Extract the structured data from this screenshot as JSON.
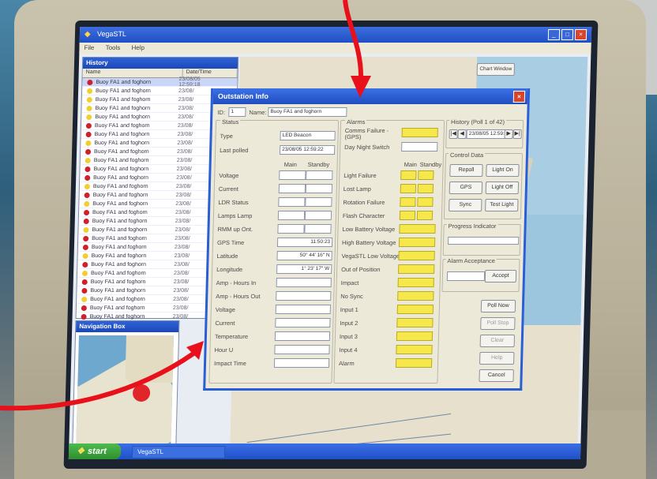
{
  "app": {
    "title": "VegaSTL",
    "menu": [
      "File",
      "Tools",
      "Help"
    ],
    "taskbar_item": "VegaSTL"
  },
  "start_label": "start",
  "history": {
    "title": "History",
    "columns": [
      "Name",
      "Date/Time"
    ],
    "rows": [
      {
        "name": "Buoy FA1 and foghorn",
        "time": "23/08/05 12:59:18",
        "status": "red"
      },
      {
        "name": "Buoy FA1 and foghorn",
        "time": "23/08/",
        "status": "yellow"
      },
      {
        "name": "Buoy FA1 and foghorn",
        "time": "23/08/",
        "status": "yellow"
      },
      {
        "name": "Buoy FA1 and foghorn",
        "time": "23/08/",
        "status": "yellow"
      },
      {
        "name": "Buoy FA1 and foghorn",
        "time": "23/08/",
        "status": "yellow"
      },
      {
        "name": "Buoy FA1 and foghorn",
        "time": "23/08/",
        "status": "red"
      },
      {
        "name": "Buoy FA1 and foghorn",
        "time": "23/08/",
        "status": "red"
      },
      {
        "name": "Buoy FA1 and foghorn",
        "time": "23/08/",
        "status": "yellow"
      },
      {
        "name": "Buoy FA1 and foghorn",
        "time": "23/08/",
        "status": "red"
      },
      {
        "name": "Buoy FA1 and foghorn",
        "time": "23/08/",
        "status": "yellow"
      },
      {
        "name": "Buoy FA1 and foghorn",
        "time": "23/08/",
        "status": "red"
      },
      {
        "name": "Buoy FA1 and foghorn",
        "time": "23/08/",
        "status": "red"
      },
      {
        "name": "Buoy FA1 and foghorn",
        "time": "23/08/",
        "status": "yellow"
      },
      {
        "name": "Buoy FA1 and foghorn",
        "time": "23/08/",
        "status": "red"
      },
      {
        "name": "Buoy FA1 and foghorn",
        "time": "23/08/",
        "status": "yellow"
      },
      {
        "name": "Buoy FA1 and foghorn",
        "time": "23/08/",
        "status": "red"
      },
      {
        "name": "Buoy FA1 and foghorn",
        "time": "23/08/",
        "status": "red"
      },
      {
        "name": "Buoy FA1 and foghorn",
        "time": "23/08/",
        "status": "yellow"
      },
      {
        "name": "Buoy FA1 and foghorn",
        "time": "23/08/",
        "status": "red"
      },
      {
        "name": "Buoy FA1 and foghorn",
        "time": "23/08/",
        "status": "red"
      },
      {
        "name": "Buoy FA1 and foghorn",
        "time": "23/08/",
        "status": "yellow"
      },
      {
        "name": "Buoy FA1 and foghorn",
        "time": "23/08/",
        "status": "red"
      },
      {
        "name": "Buoy FA1 and foghorn",
        "time": "23/08/",
        "status": "yellow"
      },
      {
        "name": "Buoy FA1 and foghorn",
        "time": "23/08/",
        "status": "red"
      },
      {
        "name": "Buoy FA1 and foghorn",
        "time": "23/08/",
        "status": "red"
      },
      {
        "name": "Buoy FA1 and foghorn",
        "time": "23/08/",
        "status": "yellow"
      },
      {
        "name": "Buoy FA1 and foghorn",
        "time": "23/08/",
        "status": "red"
      },
      {
        "name": "Buoy FA1 and foghorn",
        "time": "23/08/",
        "status": "red"
      }
    ]
  },
  "navbox": {
    "title": "Navigation Box"
  },
  "map": {
    "chart_button": "Chart Window"
  },
  "dialog": {
    "title": "Outstation Info",
    "id_label": "ID:",
    "id_value": "1",
    "name_label": "Name:",
    "name_value": "Buoy FA1 and foghorn",
    "status_group": "Status",
    "type_label": "Type",
    "type_value": "LED Beacon",
    "last_polled_label": "Last polled",
    "last_polled_value": "23/08/05 12:59:22",
    "main_col": "Main",
    "standby_col": "Standby",
    "status_fields": [
      {
        "label": "Voltage",
        "value": ""
      },
      {
        "label": "Current",
        "value": ""
      },
      {
        "label": "LDR Status",
        "value": ""
      },
      {
        "label": "Lamps Lamp",
        "value": ""
      },
      {
        "label": "RMM up Ont.",
        "value": ""
      },
      {
        "label": "GPS Time",
        "value": "11:50:23"
      },
      {
        "label": "Latitude",
        "value": "50° 44' 16\" N"
      },
      {
        "label": "Longitude",
        "value": "1° 23' 17\" W"
      },
      {
        "label": "Amp - Hours In",
        "value": ""
      },
      {
        "label": "Amp - Hours Out",
        "value": ""
      },
      {
        "label": "Voltage",
        "value": ""
      },
      {
        "label": "Current",
        "value": ""
      },
      {
        "label": "Temperature",
        "value": ""
      },
      {
        "label": "Hour U",
        "value": ""
      },
      {
        "label": "Impact Time",
        "value": ""
      }
    ],
    "alarms_group": "Alarms",
    "comms_failure_label": "Comms Failure - (GPS)",
    "day_night_label": "Day Night Switch",
    "alarms_main_col": "Main",
    "alarms_standby_col": "Standby",
    "alarm_pairs": [
      "Light Failure",
      "Lost Lamp",
      "Rotation Failure",
      "Flash Character"
    ],
    "alarm_singles": [
      "Low Battery Voltage",
      "High Battery Voltage",
      "VegaSTL Low Voltage",
      "Out of Position",
      "Impact",
      "No Sync",
      "Input 1",
      "Input 2",
      "Input 3",
      "Input 4",
      "Alarm"
    ],
    "history_group": "History (Poll 1 of 42)",
    "history_date": "23/08/05 12:59:2",
    "control_group": "Control Data",
    "control_buttons": [
      "Repoll",
      "Light On",
      "GPS",
      "Light Off",
      "Sync",
      "Test Light"
    ],
    "progress_group": "Progress Indicator",
    "alarm_ack_group": "Alarm Acceptance",
    "accept_label": "Accept",
    "side_buttons": [
      "Poll Now",
      "Poll Stop",
      "Clear",
      "Help",
      "Cancel"
    ],
    "side_buttons_disabled": [
      false,
      true,
      true,
      true,
      false
    ]
  }
}
